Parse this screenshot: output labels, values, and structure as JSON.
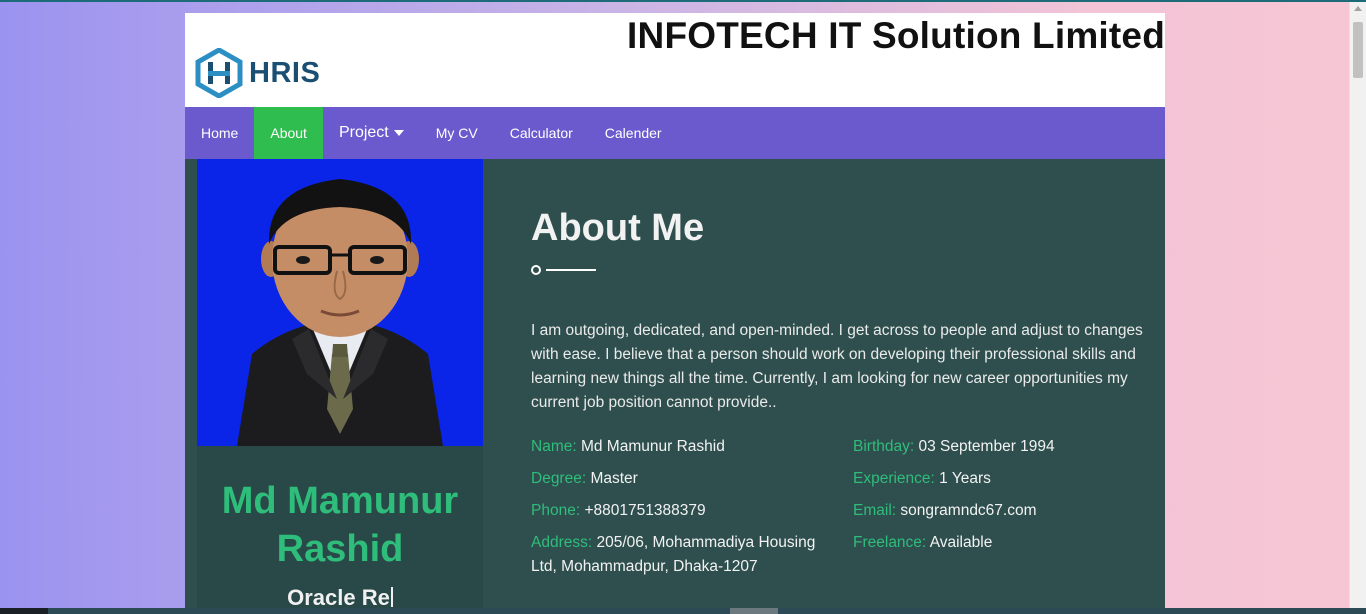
{
  "company": "INFOTECH IT Solution Limited",
  "logo": {
    "text": "HRIS",
    "icon": "hris-logo-icon"
  },
  "nav": {
    "items": [
      {
        "label": "Home"
      },
      {
        "label": "About"
      },
      {
        "label": "Project"
      },
      {
        "label": "My CV"
      },
      {
        "label": "Calculator"
      },
      {
        "label": "Calender"
      }
    ]
  },
  "profile": {
    "name_line1": "Md Mamunur",
    "name_line2": "Rashid",
    "role": "Oracle Re"
  },
  "about": {
    "title": "About Me",
    "bio": "I am outgoing, dedicated, and open-minded. I get across to people and adjust to changes with ease. I believe that a person should work on developing their professional skills and learning new things all the time. Currently, I am looking for new career opportunities my current job position cannot provide..",
    "fields": {
      "name": {
        "label": "Name:",
        "value": "Md Mamunur Rashid"
      },
      "degree": {
        "label": "Degree:",
        "value": "Master"
      },
      "phone": {
        "label": "Phone:",
        "value": "+8801751388379"
      },
      "address": {
        "label": "Address:",
        "value": "205/06, Mohammadiya Housing Ltd, Mohammadpur, Dhaka-1207"
      },
      "birthday": {
        "label": "Birthday:",
        "value": "03 September 1994"
      },
      "experience": {
        "label": "Experience:",
        "value": "1 Years"
      },
      "email": {
        "label": "Email:",
        "value": "songramndc67.com"
      },
      "freelance": {
        "label": "Freelance:",
        "value": "Available"
      }
    }
  },
  "colors": {
    "nav_bg": "#6a5acd",
    "nav_active": "#2ebd4e",
    "content_bg": "#2f4f4f",
    "accent": "#2ebd7a",
    "photo_bg": "#0a25e8"
  }
}
